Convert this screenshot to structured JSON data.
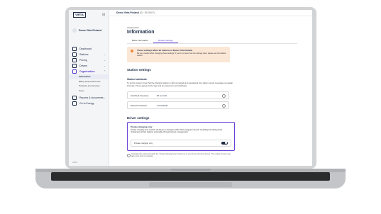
{
  "app": {
    "logo": "VIRTA",
    "org_name": "Demo Virta Finland",
    "topbar_title": "Demo Virta Finland",
    "topbar_id": "(ID: 2819467)"
  },
  "sidebar": {
    "items": [
      {
        "label": "Dashboard",
        "icon": "dashboard-icon"
      },
      {
        "label": "Stations",
        "icon": "station-icon",
        "chevron": "⌄"
      },
      {
        "label": "Pricing",
        "icon": "pricing-icon",
        "chevron": "⌄"
      },
      {
        "label": "Drivers",
        "icon": "drivers-icon",
        "chevron": "⌄"
      },
      {
        "label": "Organisation",
        "icon": "organisation-icon",
        "chevron": "⌃"
      }
    ],
    "sub_items": [
      "Information",
      "Billing and preferences",
      "Products and services",
      "Team"
    ],
    "bottom_items": [
      {
        "label": "Reports & documents",
        "icon": "reports-icon",
        "chevron": "⌄"
      },
      {
        "label": "Go to Energy",
        "icon": "energy-icon"
      }
    ],
    "footer": "VIRTA"
  },
  "main": {
    "eyebrow": "Organisation",
    "title": "Information",
    "tabs": [
      "Basic information",
      "Default settings"
    ],
    "warning": {
      "title": "These settings affect all stations of Demo Virta Finland",
      "body": "Be very careful when changing these settings. If you're not sure how the settings work, please see the default values."
    },
    "station_settings": {
      "heading": "Station settings",
      "sub_heading": "Station heartbeats",
      "description": "To let the system know that the charging station is still connected and operational, the station sends messages at regular intervals. These appear in the logs and are referred to as heartbeats.",
      "fields": [
        {
          "label": "Heartbeat frequency",
          "value": "60 seconds"
        },
        {
          "label": "Missed heartbeats",
          "value": "6 heartbeats"
        }
      ]
    },
    "driver_settings": {
      "heading": "Driver settings",
      "box_title": "Private charging only",
      "box_body": "Private charging only restricts all drivers to chargers within their assigned network. Enabling this setting limits charging to private stations accessible through access management.",
      "toggle_label": "Private charging only",
      "toggle_on": true,
      "footnote": "Changing this setting will apply the \"private charging only\" preference to all current and future drivers. The update process may take some time to complete."
    }
  }
}
